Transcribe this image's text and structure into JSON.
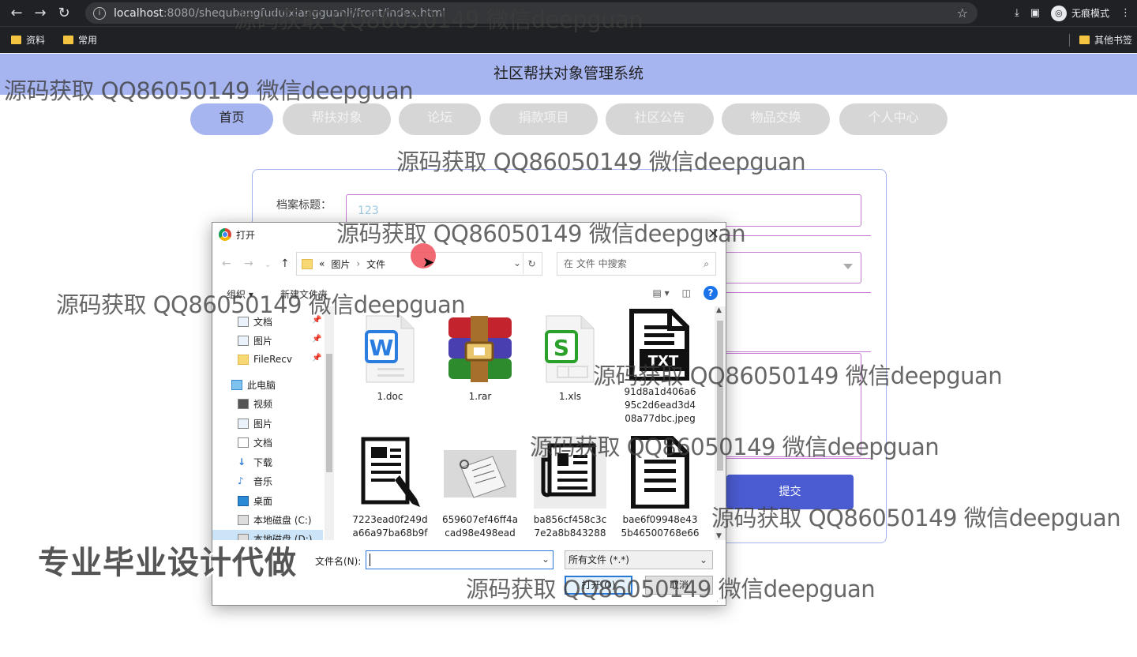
{
  "browser": {
    "url_host": "localhost",
    "url_rest": ":8080/shequbangfuduixiangguanli/front/index.html",
    "incognito_label": "无痕模式",
    "bookmarks": [
      "资料",
      "常用"
    ],
    "other_bookmarks": "其他书签"
  },
  "header": {
    "title": "社区帮扶对象管理系统"
  },
  "nav": [
    {
      "label": "首页",
      "active": true
    },
    {
      "label": "帮扶对象",
      "active": false
    },
    {
      "label": "论坛",
      "active": false
    },
    {
      "label": "捐款项目",
      "active": false
    },
    {
      "label": "社区公告",
      "active": false
    },
    {
      "label": "物品交换",
      "active": false
    },
    {
      "label": "个人中心",
      "active": false
    }
  ],
  "form": {
    "title_label": "档案标题：",
    "title_value": "123",
    "submit_label": "提交"
  },
  "dialog": {
    "title": "打开",
    "path": [
      "«",
      "图片",
      "文件"
    ],
    "search_placeholder": "在 文件 中搜索",
    "organize": "组织 ▾",
    "new_folder": "新建文件夹",
    "sidebar": [
      {
        "label": "文档",
        "pinned": true
      },
      {
        "label": "图片",
        "pinned": true
      },
      {
        "label": "FileRecv",
        "pinned": true
      },
      {
        "label": "此电脑",
        "pinned": false
      },
      {
        "label": "视频",
        "pinned": false
      },
      {
        "label": "图片",
        "pinned": false
      },
      {
        "label": "文档",
        "pinned": false
      },
      {
        "label": "下载",
        "pinned": false
      },
      {
        "label": "音乐",
        "pinned": false
      },
      {
        "label": "桌面",
        "pinned": false
      },
      {
        "label": "本地磁盘 (C:)",
        "pinned": false
      },
      {
        "label": "本地磁盘 (D:)",
        "pinned": false
      }
    ],
    "files": [
      {
        "name": "1.doc",
        "icon": "wps-writer-icon"
      },
      {
        "name": "1.rar",
        "icon": "winrar-icon"
      },
      {
        "name": "1.xls",
        "icon": "wps-spreadsheet-icon"
      },
      {
        "name": "91d8a1d406a6\n95c2d6ead3d4\n08a77dbc.jpeg",
        "icon": "txt-file-icon"
      },
      {
        "name": "7223ead0f249d\na66a97ba68b9f",
        "icon": "document-pen-icon"
      },
      {
        "name": "659607ef46ff4a\ncad98e498ead",
        "icon": "paper-photo-icon"
      },
      {
        "name": "ba856cf458c3c\n7e2a8b843288",
        "icon": "newspaper-icon"
      },
      {
        "name": "bae6f09948e43\n5b46500768e66",
        "icon": "document-lines-icon"
      }
    ],
    "filename_label": "文件名(N):",
    "filename_value": "",
    "filetype": "所有文件 (*.*)",
    "open_label": "打开(O)",
    "cancel_label": "取消"
  },
  "watermarks": [
    "源码获取 QQ86050149 微信deepguan"
  ],
  "promo": "专业毕业设计代做"
}
